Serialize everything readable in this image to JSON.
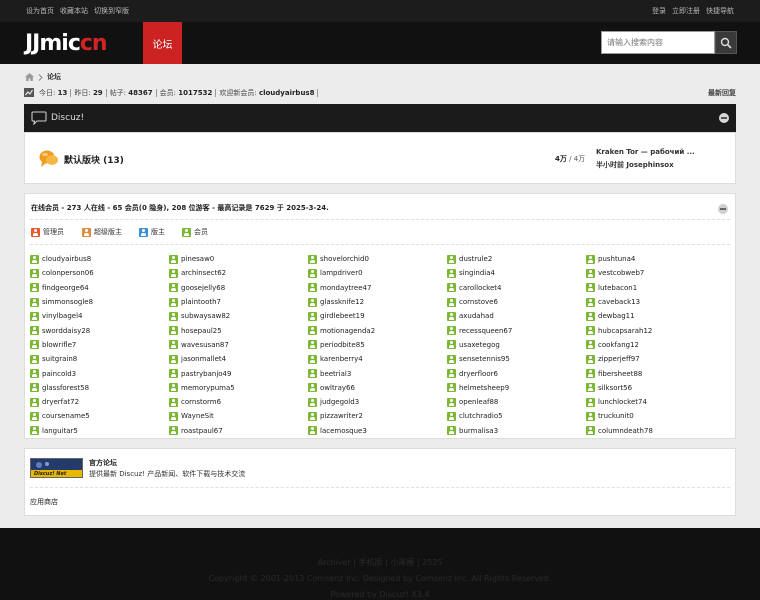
{
  "topbar": {
    "left": [
      "设为首页",
      "收藏本站",
      "切换到窄版"
    ],
    "right": [
      "登录",
      "立即注册",
      "快捷导航"
    ]
  },
  "header": {
    "logo_white": "JJmic",
    "logo_red": "cn",
    "nav_forum": "论坛",
    "search_placeholder": "请输入搜索内容"
  },
  "breadcrumb": {
    "current": "论坛"
  },
  "stats": {
    "today_label": "今日:",
    "today": "13",
    "yesterday_label": "昨日:",
    "yesterday": "29",
    "posts_label": "帖子:",
    "posts": "48367",
    "members_label": "会员:",
    "members": "1017532",
    "welcome_label": "欢迎新会员:",
    "welcome": "cloudyairbus8",
    "latest_reply": "最新回复"
  },
  "category": {
    "name": "Discuz!",
    "forum_name": "默认版块 (13)",
    "threads": "4万",
    "slash": " / ",
    "posts": "4万",
    "last_title": "Kraken Tor — рабочий ...",
    "last_meta": "半小时前 Josephinsox"
  },
  "online": {
    "title": "在线会员 - 273 人在线 - 65 会员(0 隐身), 208 位游客 - 最高记录是 7629 于 2025-3-24.",
    "legend": [
      {
        "label": "管理员",
        "color": "#e25a2b"
      },
      {
        "label": "超级版主",
        "color": "#e08a3c"
      },
      {
        "label": "版主",
        "color": "#3d8fd8"
      },
      {
        "label": "会员",
        "color": "#7cb836"
      }
    ],
    "member_color": "#7cb836",
    "members": [
      "cloudyairbus8",
      "pinesaw0",
      "shovelorchid0",
      "dustrule2",
      "pushtuna4",
      "colonperson06",
      "archinsect62",
      "lampdriver0",
      "singindia4",
      "vestcobweb7",
      "findgeorge64",
      "goosejelly68",
      "mondaytree47",
      "carollocket4",
      "lutebacon1",
      "simmonsogle8",
      "plaintooth7",
      "glassknife12",
      "cornstove6",
      "caveback13",
      "vinylbagel4",
      "subwaysaw82",
      "girdlebeet19",
      "axudahad",
      "dewbag11",
      "sworddaisy28",
      "hosepaul25",
      "motionagenda2",
      "recessqueen67",
      "hubcapsarah12",
      "blowrifle7",
      "wavesusan87",
      "periodbite85",
      "usaxetegog",
      "cookfang12",
      "suitgrain8",
      "jasonmallet4",
      "karenberry4",
      "sensetennis95",
      "zipperjeff97",
      "paincold3",
      "pastrybanjo49",
      "beetrial3",
      "dryerfloor6",
      "fibersheet88",
      "glassforest58",
      "memorypuma5",
      "owltray66",
      "helmetsheep9",
      "silksort56",
      "dryerfat72",
      "cornstorm6",
      "judgegold3",
      "openleaf88",
      "lunchlocket74",
      "coursename5",
      "WayneSit",
      "pizzawriter2",
      "clutchradio5",
      "truckunit0",
      "languitar5",
      "roastpaul67",
      "lacemosque3",
      "burmalisa3",
      "columndeath78"
    ]
  },
  "links": {
    "banner_text": "Discuz! Net",
    "name": "官方论坛",
    "desc": "提供最新 Discuz! 产品新闻、软件下载与技术交流",
    "app": "应用商店"
  },
  "footer": {
    "line1": "Archiver | 手机版 | 小黑屋 | 2525",
    "line2": "Copyright © 2001-2013 Comsenz Inc. Designed by Comsenz Inc. All Rights Reserved.",
    "line3": "Powered by Discuz! X3.4"
  }
}
